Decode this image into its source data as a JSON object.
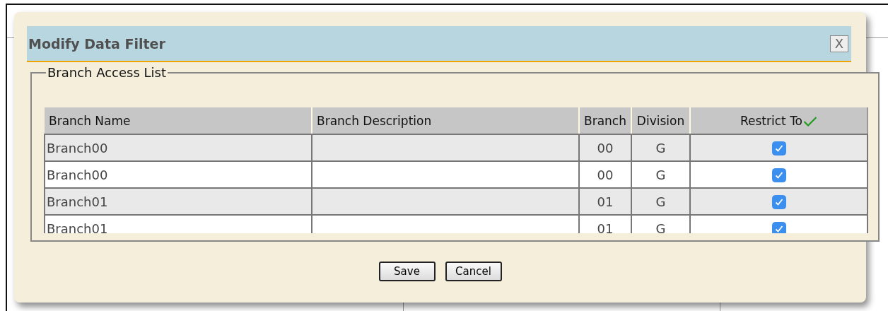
{
  "dialog": {
    "title": "Modify Data Filter",
    "close_label": "X",
    "fieldset": {
      "legend": "Branch Access List",
      "table": {
        "columns": [
          "Branch Name",
          "Branch Description",
          "Branch",
          "Division",
          "Restrict To"
        ],
        "rows": [
          {
            "name": "Branch00",
            "branch": "00",
            "division": "G",
            "checked": true
          },
          {
            "name": "Branch00",
            "branch": "00",
            "division": "G",
            "checked": true
          },
          {
            "name": "Branch01",
            "branch": "01",
            "division": "G",
            "checked": true
          },
          {
            "name": "Branch01",
            "branch": "01",
            "division": "G",
            "checked": true
          }
        ]
      }
    }
  },
  "buttons": [
    "Save",
    "Cancel"
  ]
}
